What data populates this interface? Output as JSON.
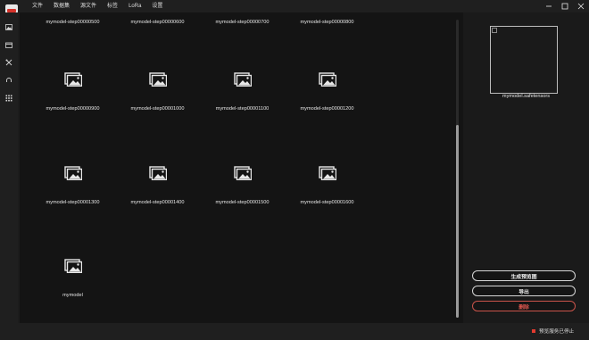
{
  "menu": [
    "文件",
    "数据集",
    "源文件",
    "标签",
    "LoRa",
    "设置"
  ],
  "tiles": [
    {
      "label": "mymodel-step00000500",
      "show_icon": false
    },
    {
      "label": "mymodel-step00000600",
      "show_icon": false
    },
    {
      "label": "mymodel-step00000700",
      "show_icon": false
    },
    {
      "label": "mymodel-step00000800",
      "show_icon": false
    },
    {
      "label": "mymodel-step00000900",
      "show_icon": true
    },
    {
      "label": "mymodel-step00001000",
      "show_icon": true
    },
    {
      "label": "mymodel-step00001100",
      "show_icon": true
    },
    {
      "label": "mymodel-step00001200",
      "show_icon": true
    },
    {
      "label": "mymodel-step00001300",
      "show_icon": true
    },
    {
      "label": "mymodel-step00001400",
      "show_icon": true
    },
    {
      "label": "mymodel-step00001500",
      "show_icon": true
    },
    {
      "label": "mymodel-step00001600",
      "show_icon": true
    },
    {
      "label": "mymodel",
      "show_icon": true
    }
  ],
  "preview": {
    "label": "mymodel.safetensors"
  },
  "buttons": {
    "generate": "生成预览图",
    "export": "导出",
    "delete": "删除"
  },
  "status": {
    "text": "预览服务已停止",
    "dot_color": "#e03a2f"
  },
  "colors": {
    "danger": "#e0584f"
  }
}
